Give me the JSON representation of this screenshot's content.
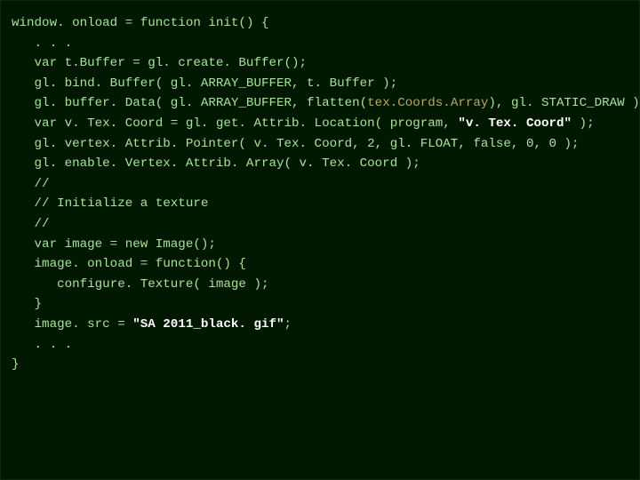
{
  "code": {
    "lines": [
      {
        "indent": 0,
        "segments": [
          {
            "text": "window. onload = function "
          },
          {
            "text": "init() {",
            "class": "fn-name"
          }
        ]
      },
      {
        "indent": 1,
        "segments": [
          {
            "text": ". . ."
          }
        ]
      },
      {
        "indent": 0,
        "segments": [
          {
            "text": ""
          }
        ]
      },
      {
        "indent": 1,
        "segments": [
          {
            "text": "var t.Buffer = gl. create. Buffer();"
          }
        ]
      },
      {
        "indent": 1,
        "segments": [
          {
            "text": "gl. bind. Buffer( gl. ARRAY_BUFFER, t. Buffer );"
          }
        ]
      },
      {
        "indent": 1,
        "segments": [
          {
            "text": "gl. buffer. Data( gl. ARRAY_BUFFER, flatten("
          },
          {
            "text": "tex.Coords.Array",
            "class": "tex-arg"
          },
          {
            "text": "), gl. STATIC_DRAW );"
          }
        ]
      },
      {
        "indent": 0,
        "segments": [
          {
            "text": ""
          }
        ]
      },
      {
        "indent": 1,
        "segments": [
          {
            "text": "var v. Tex. Coord = gl. get. Attrib. Location( program, "
          },
          {
            "text": "\"v. Tex. Coord\"",
            "class": "string"
          },
          {
            "text": " );"
          }
        ]
      },
      {
        "indent": 1,
        "segments": [
          {
            "text": "gl. vertex. Attrib. Pointer( v. Tex. Coord, 2, gl. FLOAT, false, 0, 0 );"
          }
        ]
      },
      {
        "indent": 1,
        "segments": [
          {
            "text": "gl. enable. Vertex. Attrib. Array( v. Tex. Coord );"
          }
        ]
      },
      {
        "indent": 0,
        "segments": [
          {
            "text": ""
          }
        ]
      },
      {
        "indent": 1,
        "segments": [
          {
            "text": "//"
          }
        ]
      },
      {
        "indent": 1,
        "segments": [
          {
            "text": "// Initialize a texture"
          }
        ]
      },
      {
        "indent": 1,
        "segments": [
          {
            "text": "//"
          }
        ]
      },
      {
        "indent": 1,
        "segments": [
          {
            "text": "var image = new Image();"
          }
        ]
      },
      {
        "indent": 1,
        "segments": [
          {
            "text": "image. onload = function() {"
          }
        ]
      },
      {
        "indent": 2,
        "segments": [
          {
            "text": "configure. Texture( image );"
          }
        ]
      },
      {
        "indent": 1,
        "segments": [
          {
            "text": "}"
          }
        ]
      },
      {
        "indent": 1,
        "segments": [
          {
            "text": "image. src = "
          },
          {
            "text": "\"SA 2011_black. gif\"",
            "class": "string"
          },
          {
            "text": ";"
          }
        ]
      },
      {
        "indent": 1,
        "segments": [
          {
            "text": ". . ."
          }
        ]
      },
      {
        "indent": 0,
        "segments": [
          {
            "text": "}"
          }
        ]
      }
    ],
    "indentUnit": "   "
  }
}
